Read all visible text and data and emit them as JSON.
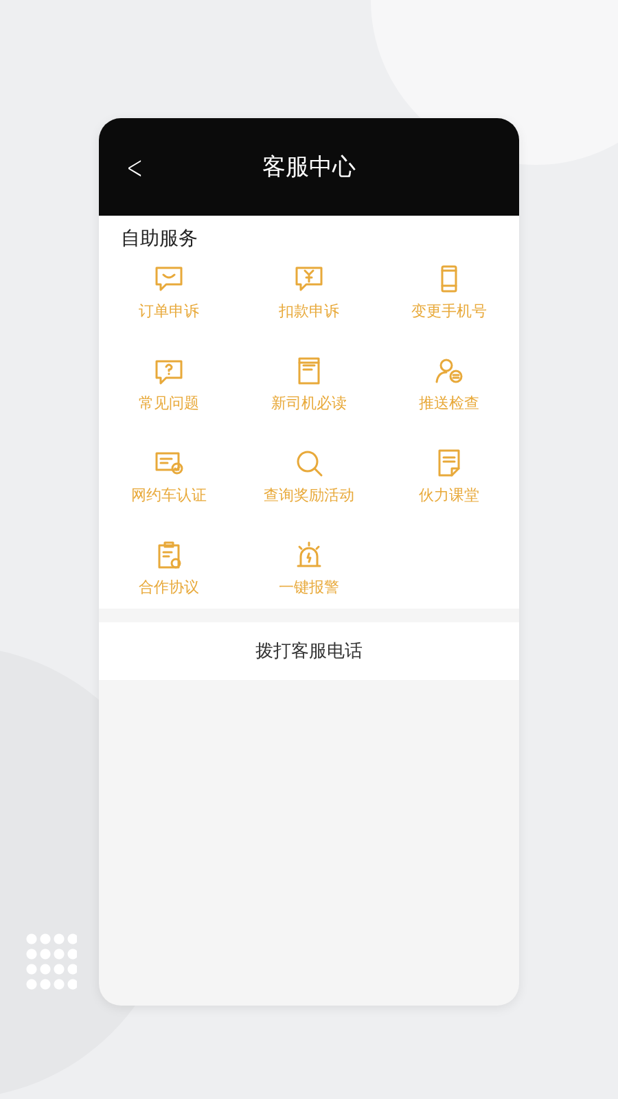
{
  "header": {
    "back": "<",
    "title": "客服中心"
  },
  "section": {
    "title": "自助服务",
    "items": [
      {
        "label": "订单申诉"
      },
      {
        "label": "扣款申诉"
      },
      {
        "label": "变更手机号"
      },
      {
        "label": "常见问题"
      },
      {
        "label": "新司机必读"
      },
      {
        "label": "推送检查"
      },
      {
        "label": "网约车认证"
      },
      {
        "label": "查询奖励活动"
      },
      {
        "label": "伙力课堂"
      },
      {
        "label": "合作协议"
      },
      {
        "label": "一键报警"
      }
    ]
  },
  "call_button": "拨打客服电话"
}
